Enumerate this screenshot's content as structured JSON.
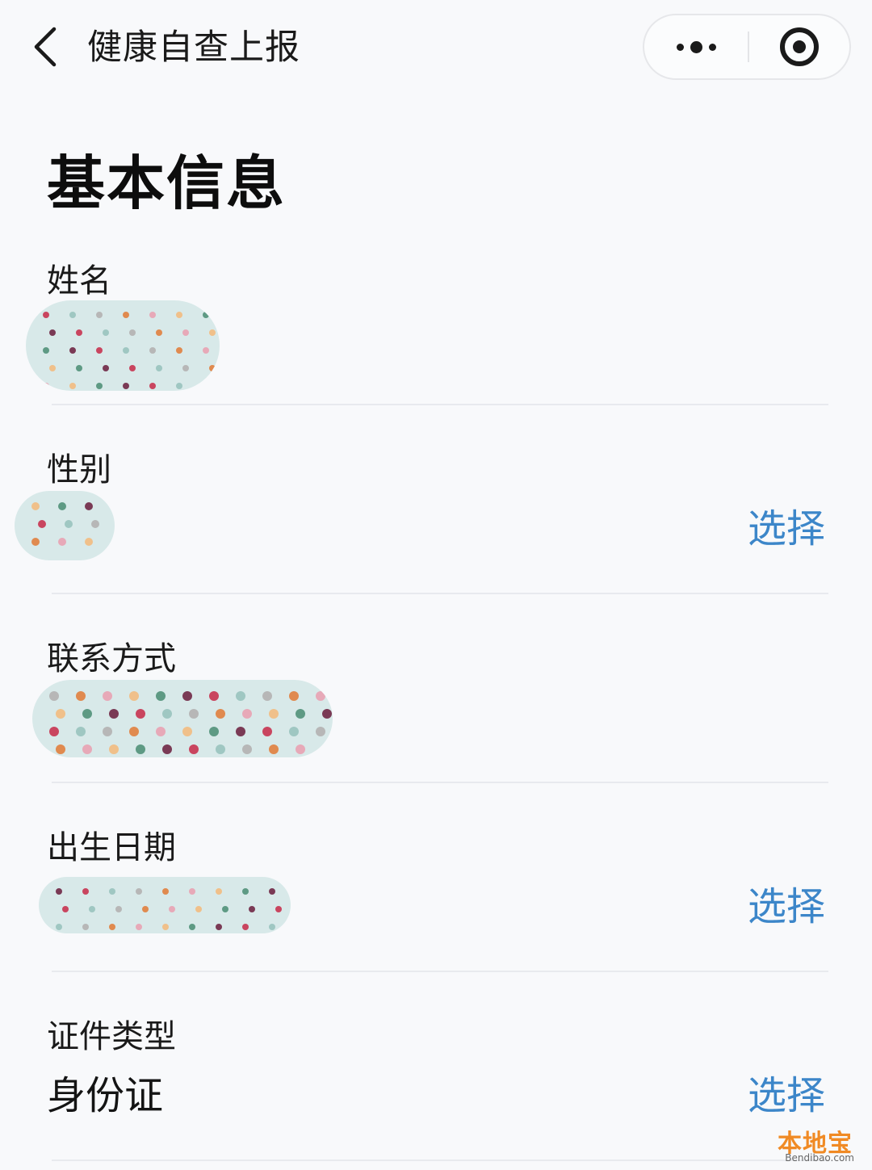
{
  "nav": {
    "back_icon": "chevron-left-icon",
    "title": "健康自查上报",
    "more_icon": "more-dots-icon",
    "close_icon": "target-icon"
  },
  "section": {
    "title": "基本信息"
  },
  "fields": [
    {
      "label": "姓名",
      "value": "",
      "redacted": true
    },
    {
      "label": "性别",
      "value": "",
      "redacted": true,
      "action": "选择"
    },
    {
      "label": "联系方式",
      "value": "",
      "redacted": true
    },
    {
      "label": "出生日期",
      "value": "",
      "redacted": true,
      "action": "选择"
    },
    {
      "label": "证件类型",
      "value": "身份证",
      "action": "选择"
    }
  ],
  "watermark": {
    "text": "本地宝",
    "sub": "Bendibao.com"
  },
  "colors": {
    "accent": "#3c86c9",
    "mask": "#d8e9e9",
    "watermark": "#f08a24"
  }
}
